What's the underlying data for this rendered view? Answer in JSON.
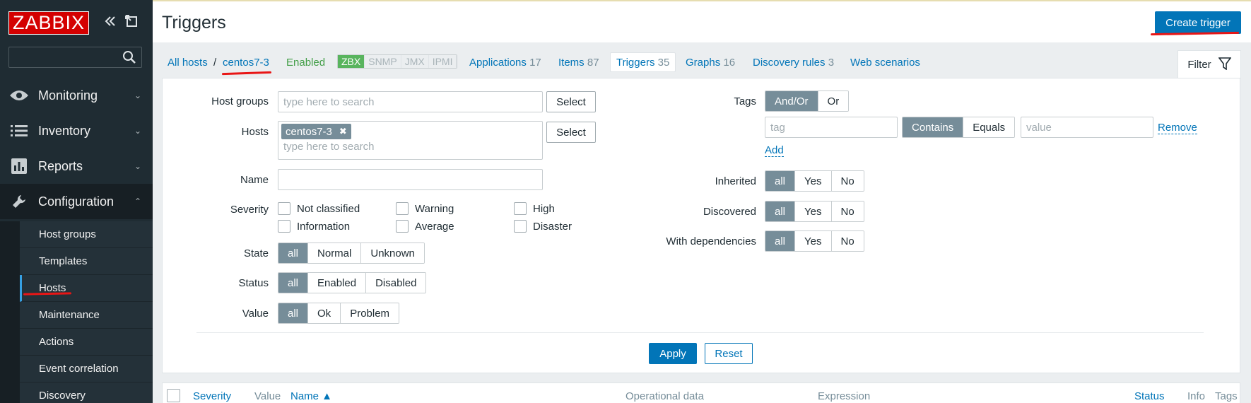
{
  "sidebar": {
    "logo": "ZABBIX",
    "collapse_icon": "chevrons-left-icon",
    "kiosk_icon": "kiosk-mode-icon",
    "search_icon": "search-icon",
    "search_value": "",
    "menu": [
      {
        "label": "Monitoring",
        "icon": "eye-icon"
      },
      {
        "label": "Inventory",
        "icon": "list-icon"
      },
      {
        "label": "Reports",
        "icon": "bar-chart-icon"
      },
      {
        "label": "Configuration",
        "icon": "wrench-icon"
      }
    ],
    "submenu": [
      "Host groups",
      "Templates",
      "Hosts",
      "Maintenance",
      "Actions",
      "Event correlation",
      "Discovery"
    ]
  },
  "header": {
    "title": "Triggers",
    "create_button": "Create trigger"
  },
  "breadcrumb": {
    "all_hosts": "All hosts",
    "separator": "/",
    "host": "centos7-3",
    "status": "Enabled",
    "availability": [
      "ZBX",
      "SNMP",
      "JMX",
      "IPMI"
    ]
  },
  "tabs": {
    "applications": {
      "label": "Applications",
      "count": "17"
    },
    "items": {
      "label": "Items",
      "count": "87"
    },
    "triggers": {
      "label": "Triggers",
      "count": "35"
    },
    "graphs": {
      "label": "Graphs",
      "count": "16"
    },
    "discovery": {
      "label": "Discovery rules",
      "count": "3"
    },
    "web": {
      "label": "Web scenarios"
    },
    "filter": "Filter",
    "filter_icon": "funnel-icon"
  },
  "filter": {
    "host_groups_label": "Host groups",
    "host_groups_placeholder": "type here to search",
    "select": "Select",
    "hosts_label": "Hosts",
    "host_chip": "centos7-3",
    "chip_remove": "✖",
    "hosts_placeholder": "type here to search",
    "name_label": "Name",
    "name_value": "",
    "severity_label": "Severity",
    "severities": [
      "Not classified",
      "Warning",
      "High",
      "Information",
      "Average",
      "Disaster"
    ],
    "state_label": "State",
    "state_options": [
      "all",
      "Normal",
      "Unknown"
    ],
    "status_label": "Status",
    "status_options": [
      "all",
      "Enabled",
      "Disabled"
    ],
    "value_label": "Value",
    "value_options": [
      "all",
      "Ok",
      "Problem"
    ],
    "tags_label": "Tags",
    "tags_options": [
      "And/Or",
      "Or"
    ],
    "tag_placeholder": "tag",
    "tag_ops": [
      "Contains",
      "Equals"
    ],
    "value_placeholder": "value",
    "remove": "Remove",
    "add": "Add",
    "inherited_label": "Inherited",
    "discovered_label": "Discovered",
    "dependencies_label": "With dependencies",
    "tri_options": [
      "all",
      "Yes",
      "No"
    ],
    "apply": "Apply",
    "reset": "Reset"
  },
  "table": {
    "headers": [
      "Severity",
      "Value",
      "Name ▲",
      "Operational data",
      "Expression",
      "Status",
      "Info",
      "Tags"
    ]
  },
  "colors": {
    "sidebar": "#1f2c33",
    "accent": "#0275b8",
    "logo": "#d40000",
    "annotation": "#e81616"
  }
}
